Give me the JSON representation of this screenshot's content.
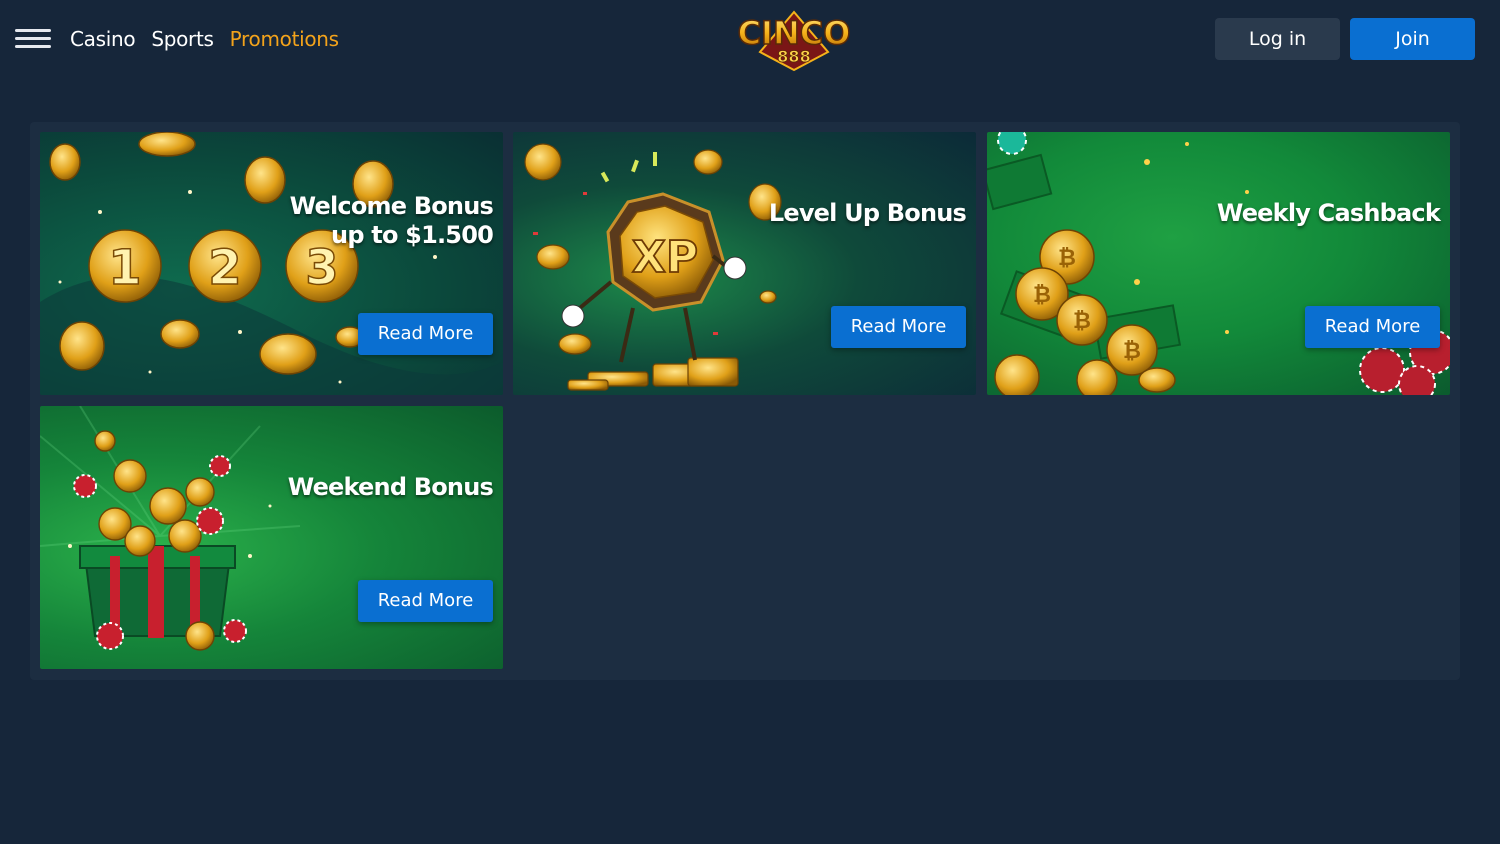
{
  "header": {
    "nav": [
      {
        "label": "Casino"
      },
      {
        "label": "Sports"
      },
      {
        "label": "Promotions",
        "active": true
      }
    ],
    "logo": {
      "text": "CINCO",
      "sub": "888"
    },
    "login_label": "Log in",
    "join_label": "Join"
  },
  "promotions": [
    {
      "title_line1": "Welcome Bonus",
      "title_line2": "up to $1.500",
      "button": "Read More"
    },
    {
      "title_line1": "Level Up Bonus",
      "button": "Read More"
    },
    {
      "title_line1": "Weekly Cashback",
      "button": "Read More"
    },
    {
      "title_line1": "Weekend Bonus",
      "button": "Read More"
    }
  ],
  "colors": {
    "background": "#16263a",
    "panel": "#1c2d41",
    "accent_blue": "#0a6fd1",
    "active_nav": "#f3a31b"
  }
}
